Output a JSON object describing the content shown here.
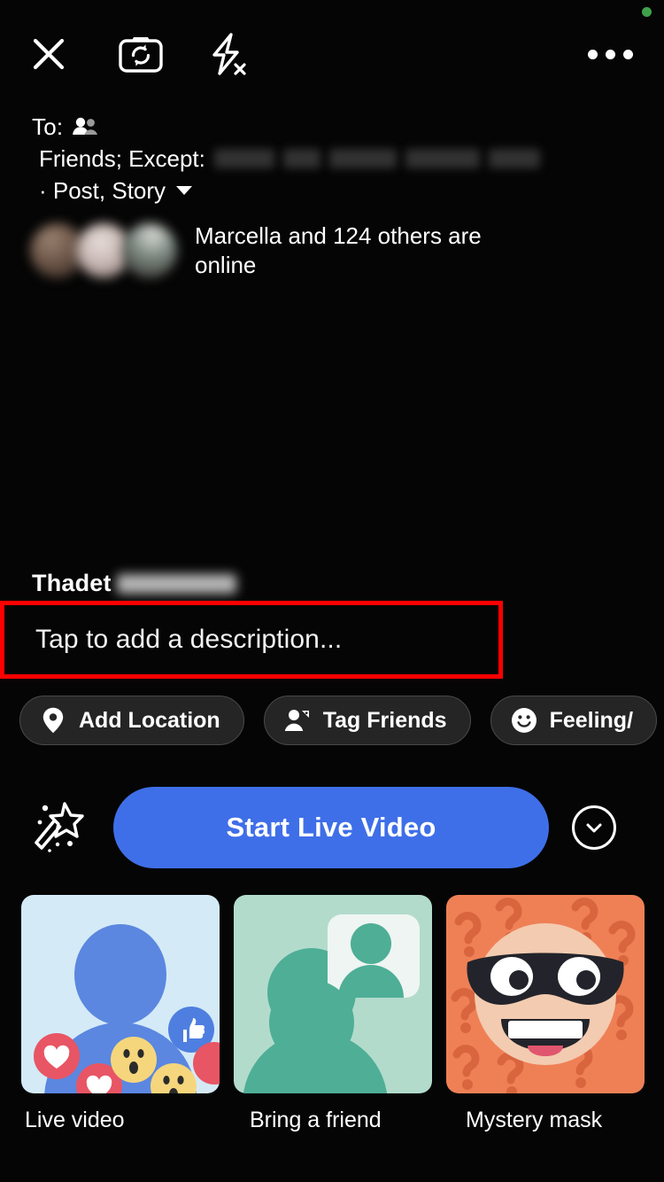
{
  "app": {
    "name": "Facebook Live composer",
    "accent_blue": "#3f6fe8",
    "highlight_red": "#fe0000",
    "background": "#050505"
  },
  "status": {
    "privacy_indicator": "green-dot"
  },
  "toolbar": {
    "close_icon": "close-icon",
    "flip_camera_icon": "camera-flip-icon",
    "flash_off_icon": "flash-off-icon",
    "more_icon": "more-options-icon"
  },
  "audience": {
    "to_label": "To:",
    "audience_icon": "friends-icon",
    "privacy_text": "Friends; Except:",
    "excluded_names_redacted": "",
    "destinations": "· Post, Story",
    "chevron_icon": "chevron-down-icon"
  },
  "online": {
    "text": "Marcella and 124 others are online",
    "avatar_count": 3
  },
  "author": {
    "first_name": "Thadet",
    "last_name_redacted": ""
  },
  "description": {
    "placeholder": "Tap to add a description...",
    "value": "",
    "highlighted": true
  },
  "chips": [
    {
      "label": "Add Location",
      "icon": "location-pin-icon"
    },
    {
      "label": "Tag Friends",
      "icon": "tag-friends-icon"
    },
    {
      "label": "Feeling/",
      "icon": "smiley-icon"
    }
  ],
  "live": {
    "effects_icon": "magic-wand-icon",
    "button_label": "Start Live Video",
    "expand_icon": "chevron-down-circle-icon"
  },
  "effect_cards": [
    {
      "label": "Live video",
      "icon": "live-video-reactions-thumbnail",
      "bg": "#d4eaf7"
    },
    {
      "label": "Bring a friend",
      "icon": "bring-a-friend-thumbnail",
      "bg": "#b2dbcc"
    },
    {
      "label": "Mystery mask",
      "icon": "mystery-mask-thumbnail",
      "bg": "#ef8056"
    }
  ]
}
